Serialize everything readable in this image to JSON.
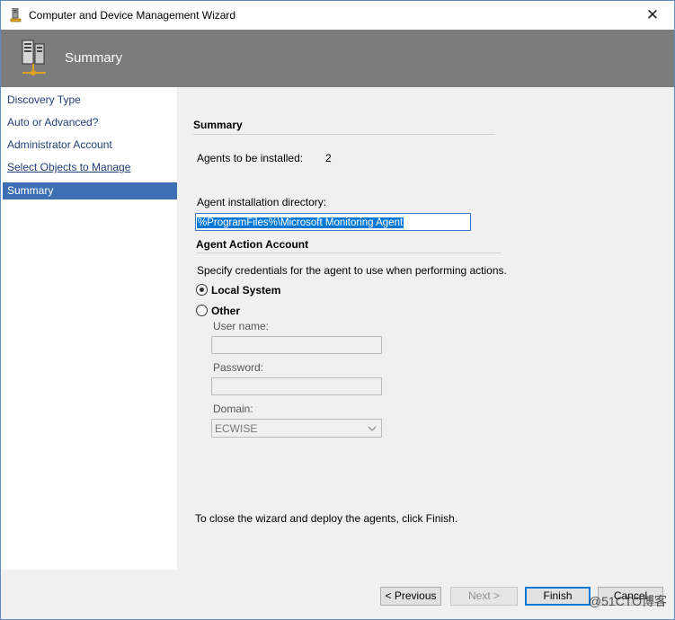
{
  "window": {
    "title": "Computer and Device Management Wizard"
  },
  "header": {
    "title": "Summary"
  },
  "nav": {
    "items": [
      {
        "label": "Discovery Type"
      },
      {
        "label": "Auto or Advanced?"
      },
      {
        "label": "Administrator Account"
      },
      {
        "label": "Select Objects to Manage"
      },
      {
        "label": "Summary"
      }
    ]
  },
  "summary": {
    "section_title": "Summary",
    "agents_label": "Agents to be installed:",
    "agents_count": "2",
    "dir_label": "Agent installation directory:",
    "dir_value": "%ProgramFiles%\\Microsoft Monitoring Agent"
  },
  "action_account": {
    "section_title": "Agent Action Account",
    "description": "Specify credentials for the agent to use when performing actions.",
    "local_system_label": "Local System",
    "other_label": "Other",
    "selected": "Local System",
    "username_label": "User name:",
    "username_value": "",
    "password_label": "Password:",
    "password_value": "",
    "domain_label": "Domain:",
    "domain_value": "ECWISE"
  },
  "footer_note": "To close the wizard and deploy the agents, click Finish.",
  "buttons": {
    "previous": "< Previous",
    "next": "Next >",
    "finish": "Finish",
    "cancel": "Cancel"
  },
  "watermark": "@51CTO博客",
  "colors": {
    "header_bg": "#7c7c7c",
    "nav_active": "#3c6fb4",
    "selection": "#0078d7"
  }
}
